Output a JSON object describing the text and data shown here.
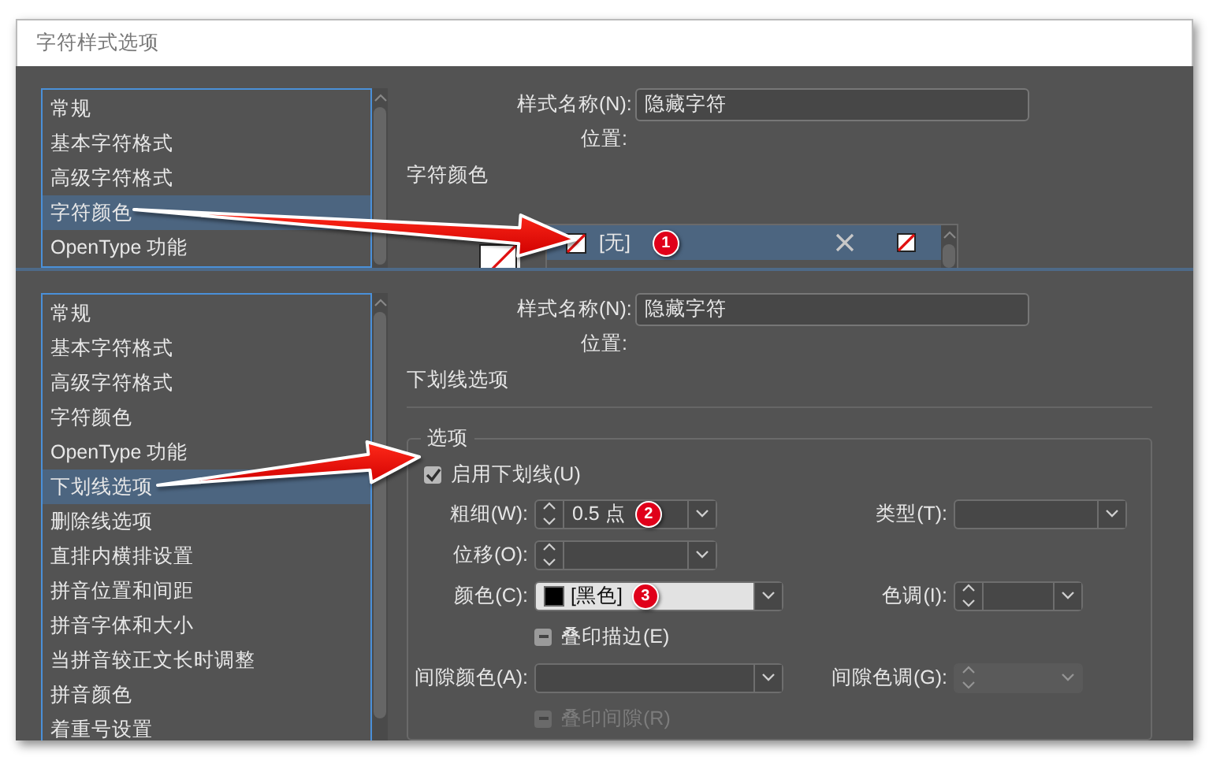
{
  "window": {
    "title": "字符样式选项"
  },
  "panels": [
    {
      "categories": [
        {
          "label": "常规",
          "selected": false
        },
        {
          "label": "基本字符格式",
          "selected": false
        },
        {
          "label": "高级字符格式",
          "selected": false
        },
        {
          "label": "字符颜色",
          "selected": true
        },
        {
          "label": "OpenType 功能",
          "selected": false
        }
      ],
      "style_name_label": "样式名称(N):",
      "style_name": "隐藏字符",
      "location_label": "位置:",
      "section_title": "字符颜色",
      "swatches": [
        {
          "name": "[无]",
          "selected": true,
          "badge": "1"
        }
      ]
    },
    {
      "categories": [
        {
          "label": "常规",
          "selected": false
        },
        {
          "label": "基本字符格式",
          "selected": false
        },
        {
          "label": "高级字符格式",
          "selected": false
        },
        {
          "label": "字符颜色",
          "selected": false
        },
        {
          "label": "OpenType 功能",
          "selected": false
        },
        {
          "label": "下划线选项",
          "selected": true
        },
        {
          "label": "删除线选项",
          "selected": false
        },
        {
          "label": "直排内横排设置",
          "selected": false
        },
        {
          "label": "拼音位置和间距",
          "selected": false
        },
        {
          "label": "拼音字体和大小",
          "selected": false
        },
        {
          "label": "当拼音较正文长时调整",
          "selected": false
        },
        {
          "label": "拼音颜色",
          "selected": false
        },
        {
          "label": "着重号设置",
          "selected": false
        }
      ],
      "style_name_label": "样式名称(N):",
      "style_name": "隐藏字符",
      "location_label": "位置:",
      "section_title": "下划线选项",
      "group": {
        "title": "选项",
        "enable": {
          "label": "启用下划线(U)",
          "checked": true
        },
        "rows": [
          [
            {
              "kind": "spinner",
              "label": "粗细(W):",
              "value": "0.5 点",
              "badge": "2",
              "disabled": false
            },
            {
              "kind": "dropdown",
              "label": "类型(T):",
              "disabled": false
            }
          ],
          [
            {
              "kind": "spinner",
              "label": "位移(O):",
              "disabled": false
            }
          ],
          [
            {
              "kind": "swatch",
              "label": "颜色(C):",
              "value": "[黑色]",
              "badge": "3",
              "disabled": false
            },
            {
              "kind": "tint",
              "label": "色调(I):",
              "disabled": false
            }
          ],
          [
            {
              "kind": "checkbox",
              "label": "叠印描边(E)",
              "indeterminate": true,
              "disabled": false
            }
          ],
          [
            {
              "kind": "dropdown-wide",
              "label": "间隙颜色(A):",
              "disabled": false
            },
            {
              "kind": "tint",
              "label": "间隙色调(G):",
              "disabled": true
            }
          ],
          [
            {
              "kind": "checkbox",
              "label": "叠印间隙(R)",
              "indeterminate": true,
              "disabled": true
            }
          ]
        ]
      }
    }
  ]
}
